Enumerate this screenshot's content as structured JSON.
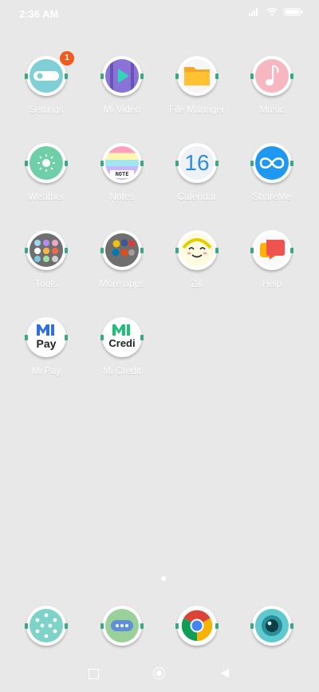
{
  "status_bar": {
    "time": "2:36 AM",
    "icons": [
      "signal-icon",
      "wifi-icon",
      "battery-icon"
    ]
  },
  "apps": [
    {
      "label": "Settings",
      "icon": "settings-icon",
      "badge": "1"
    },
    {
      "label": "Mi Video",
      "icon": "mi-video-icon"
    },
    {
      "label": "File Manager",
      "icon": "folder-icon"
    },
    {
      "label": "Music",
      "icon": "music-icon"
    },
    {
      "label": "Weather",
      "icon": "weather-icon"
    },
    {
      "label": "Notes",
      "icon": "notes-icon",
      "icon_text": "NOTE"
    },
    {
      "label": "Calendar",
      "icon": "calendar-icon",
      "icon_text": "16"
    },
    {
      "label": "ShareMe",
      "icon": "shareme-icon"
    },
    {
      "label": "Tools",
      "icon": "tools-folder-icon"
    },
    {
      "label": "More apps",
      "icon": "more-apps-folder-icon"
    },
    {
      "label": "Zili",
      "icon": "zili-icon"
    },
    {
      "label": "Help",
      "icon": "help-icon"
    },
    {
      "label": "Mi Pay",
      "icon": "mi-pay-icon",
      "icon_text": "Pay"
    },
    {
      "label": "Mi Credit",
      "icon": "mi-credit-icon",
      "icon_text": "Credi"
    }
  ],
  "dock": [
    {
      "icon": "phone-icon"
    },
    {
      "icon": "messaging-icon"
    },
    {
      "icon": "chrome-icon"
    },
    {
      "icon": "camera-icon"
    }
  ],
  "navigation": [
    "recents-button",
    "home-button",
    "back-button"
  ],
  "colors": {
    "background": "#e8e8e8",
    "badge": "#ef5a1f",
    "ring_accent": "#3aa68a"
  }
}
